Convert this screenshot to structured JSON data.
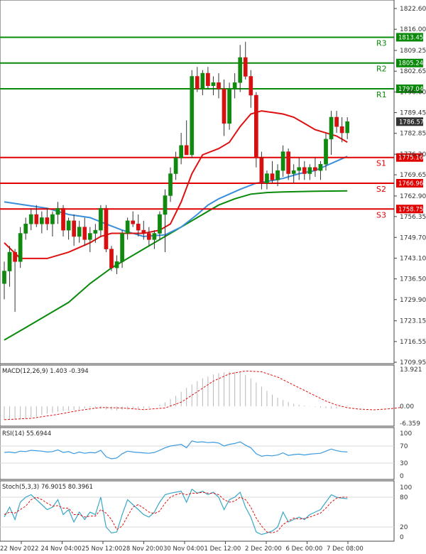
{
  "chart_data": {
    "type": "candlestick",
    "price_axis_ticks": [
      "1822.60",
      "1816.00",
      "1809.25",
      "1802.65",
      "1796.00",
      "1789.45",
      "1782.85",
      "1776.20",
      "1769.65",
      "1762.90",
      "1756.35",
      "1749.70",
      "1743.10",
      "1736.50",
      "1729.90",
      "1723.15",
      "1716.55",
      "1709.95"
    ],
    "price_range": [
      1709.95,
      1822.6
    ],
    "x_labels": [
      "22 Nov 2022",
      "24 Nov 04:00",
      "25 Nov 12:00",
      "28 Nov 20:00",
      "30 Nov 04:00",
      "1 Dec 12:00",
      "2 Dec 20:00",
      "6 Dec 00:00",
      "7 Dec 08:00"
    ],
    "last_price": "1786.57",
    "levels": [
      {
        "name": "R3",
        "value": 1813.45,
        "value_label": "1813.45",
        "color": "#0a8a0a"
      },
      {
        "name": "R2",
        "value": 1805.24,
        "value_label": "1805.24",
        "color": "#0a8a0a"
      },
      {
        "name": "R1",
        "value": 1797.04,
        "value_label": "1797.04",
        "color": "#0a8a0a"
      },
      {
        "name": "S1",
        "value": 1775.16,
        "value_label": "1775.16",
        "color": "#e00000"
      },
      {
        "name": "S2",
        "value": 1766.96,
        "value_label": "1766.96",
        "color": "#e00000"
      },
      {
        "name": "S3",
        "value": 1758.75,
        "value_label": "1758.75",
        "color": "#e00000"
      }
    ],
    "candles": [
      [
        1735,
        1742,
        1730,
        1739
      ],
      [
        1739,
        1747,
        1734,
        1745
      ],
      [
        1745,
        1746,
        1726,
        1742
      ],
      [
        1742,
        1753,
        1740,
        1751
      ],
      [
        1751,
        1756,
        1749,
        1754
      ],
      [
        1754,
        1759,
        1752,
        1757
      ],
      [
        1757,
        1760,
        1753,
        1754
      ],
      [
        1754,
        1758,
        1751,
        1756
      ],
      [
        1756,
        1759,
        1752,
        1754
      ],
      [
        1754,
        1758,
        1750,
        1757
      ],
      [
        1757,
        1761,
        1754,
        1759
      ],
      [
        1759,
        1760,
        1750,
        1752
      ],
      [
        1752,
        1756,
        1749,
        1755
      ],
      [
        1755,
        1757,
        1747,
        1750
      ],
      [
        1750,
        1755,
        1748,
        1753
      ],
      [
        1753,
        1756,
        1747,
        1749
      ],
      [
        1749,
        1753,
        1745,
        1751
      ],
      [
        1751,
        1754,
        1748,
        1752
      ],
      [
        1752,
        1760,
        1750,
        1759
      ],
      [
        1759,
        1760,
        1745,
        1746
      ],
      [
        1746,
        1747,
        1739,
        1740
      ],
      [
        1740,
        1744,
        1738,
        1742
      ],
      [
        1742,
        1752,
        1740,
        1751
      ],
      [
        1751,
        1756,
        1749,
        1755
      ],
      [
        1755,
        1758,
        1753,
        1754
      ],
      [
        1754,
        1757,
        1750,
        1752
      ],
      [
        1752,
        1755,
        1749,
        1751
      ],
      [
        1751,
        1753,
        1747,
        1749
      ],
      [
        1749,
        1752,
        1746,
        1751
      ],
      [
        1751,
        1758,
        1749,
        1757
      ],
      [
        1757,
        1765,
        1745,
        1763
      ],
      [
        1763,
        1772,
        1761,
        1770
      ],
      [
        1770,
        1777,
        1768,
        1775
      ],
      [
        1775,
        1783,
        1773,
        1779
      ],
      [
        1779,
        1787,
        1777,
        1776
      ],
      [
        1776,
        1803,
        1775,
        1801
      ],
      [
        1801,
        1804,
        1796,
        1797
      ],
      [
        1797,
        1803,
        1795,
        1802
      ],
      [
        1802,
        1804,
        1797,
        1798
      ],
      [
        1798,
        1801,
        1795,
        1799
      ],
      [
        1799,
        1802,
        1794,
        1797
      ],
      [
        1797,
        1800,
        1782,
        1786
      ],
      [
        1786,
        1799,
        1784,
        1797
      ],
      [
        1797,
        1802,
        1794,
        1799
      ],
      [
        1799,
        1811,
        1796,
        1807
      ],
      [
        1807,
        1812,
        1800,
        1801
      ],
      [
        1801,
        1803,
        1791,
        1795
      ],
      [
        1795,
        1796,
        1772,
        1775
      ],
      [
        1775,
        1777,
        1765,
        1767
      ],
      [
        1767,
        1771,
        1765,
        1770
      ],
      [
        1770,
        1774,
        1767,
        1768
      ],
      [
        1768,
        1773,
        1766,
        1771
      ],
      [
        1771,
        1779,
        1769,
        1777
      ],
      [
        1777,
        1778,
        1768,
        1770
      ],
      [
        1770,
        1773,
        1767,
        1771
      ],
      [
        1771,
        1775,
        1768,
        1772
      ],
      [
        1772,
        1774,
        1768,
        1770
      ],
      [
        1770,
        1773,
        1768,
        1772
      ],
      [
        1772,
        1775,
        1769,
        1771
      ],
      [
        1771,
        1774,
        1768,
        1773
      ],
      [
        1773,
        1783,
        1771,
        1781
      ],
      [
        1781,
        1790,
        1776,
        1788
      ],
      [
        1788,
        1790,
        1783,
        1785
      ],
      [
        1785,
        1788,
        1780,
        1783
      ],
      [
        1783,
        1788,
        1781,
        1786.57
      ]
    ],
    "ma_red": [
      [
        0,
        1748
      ],
      [
        3,
        1743
      ],
      [
        8,
        1743
      ],
      [
        12,
        1745
      ],
      [
        16,
        1748
      ],
      [
        18,
        1750
      ],
      [
        20,
        1751
      ],
      [
        26,
        1751
      ],
      [
        29,
        1752
      ],
      [
        31,
        1754
      ],
      [
        33,
        1761
      ],
      [
        35,
        1770
      ],
      [
        37,
        1776
      ],
      [
        40,
        1778
      ],
      [
        42,
        1780
      ],
      [
        44,
        1785
      ],
      [
        46,
        1789
      ],
      [
        48,
        1790
      ],
      [
        50,
        1789.5
      ],
      [
        52,
        1789
      ],
      [
        54,
        1788
      ],
      [
        56,
        1786
      ],
      [
        58,
        1784
      ],
      [
        60,
        1783
      ],
      [
        62,
        1782
      ],
      [
        64,
        1780
      ]
    ],
    "ma_blue": [
      [
        0,
        1761
      ],
      [
        4,
        1760
      ],
      [
        8,
        1759
      ],
      [
        12,
        1757
      ],
      [
        16,
        1756
      ],
      [
        19,
        1754
      ],
      [
        22,
        1752
      ],
      [
        26,
        1750
      ],
      [
        30,
        1750.5
      ],
      [
        33,
        1753
      ],
      [
        36,
        1757
      ],
      [
        38,
        1760
      ],
      [
        40,
        1762
      ],
      [
        44,
        1765
      ],
      [
        47,
        1767
      ],
      [
        49,
        1767.5
      ],
      [
        52,
        1768.5
      ],
      [
        55,
        1770
      ],
      [
        58,
        1771
      ],
      [
        60,
        1772.5
      ],
      [
        62,
        1774
      ],
      [
        64,
        1775.5
      ]
    ],
    "ma_green": [
      [
        0,
        1717
      ],
      [
        4,
        1721
      ],
      [
        8,
        1725
      ],
      [
        12,
        1729
      ],
      [
        16,
        1735
      ],
      [
        20,
        1740
      ],
      [
        24,
        1744
      ],
      [
        28,
        1748
      ],
      [
        32,
        1752
      ],
      [
        36,
        1756
      ],
      [
        40,
        1760
      ],
      [
        43,
        1762
      ],
      [
        46,
        1763.5
      ],
      [
        49,
        1764
      ],
      [
        52,
        1764.2
      ],
      [
        55,
        1764.3
      ],
      [
        58,
        1764.4
      ],
      [
        64,
        1764.5
      ]
    ],
    "macd": {
      "label": "MACD(12,26,9) 1.403 -0.394",
      "axis_ticks": [
        "13.921",
        "0.00",
        "-6.359"
      ],
      "range": [
        -6.359,
        13.921
      ],
      "hist": [
        -5,
        -5,
        -5,
        -4.8,
        -4.5,
        -4.2,
        -3.8,
        -3.2,
        -2.8,
        -2.5,
        -2,
        -1.7,
        -1.5,
        -1.3,
        -1,
        -0.8,
        -0.6,
        -0.8,
        -1,
        -1.2,
        -1.4,
        -1.5,
        -1.3,
        -1.2,
        -1.1,
        -1,
        -0.8,
        -0.5,
        0,
        0.6,
        1.5,
        2.7,
        4,
        5.5,
        7,
        8.2,
        9.5,
        10.5,
        11.2,
        12,
        12.5,
        12.8,
        13,
        13,
        12.7,
        11.8,
        10.5,
        9,
        7.4,
        5.8,
        4.4,
        3.3,
        2.4,
        1.6,
        1,
        0.6,
        0.3,
        0.1,
        -0.2,
        -0.5,
        -0.7,
        -0.9,
        -0.7,
        -0.2,
        0.3
      ],
      "signal": [
        [
          0,
          -5
        ],
        [
          5,
          -4.5
        ],
        [
          10,
          -3
        ],
        [
          14,
          -1.5
        ],
        [
          18,
          -0.4
        ],
        [
          22,
          -0.6
        ],
        [
          26,
          -1.2
        ],
        [
          30,
          -0.6
        ],
        [
          33,
          1.6
        ],
        [
          36,
          5.5
        ],
        [
          39,
          9.5
        ],
        [
          42,
          12.2
        ],
        [
          45,
          13.3
        ],
        [
          48,
          13
        ],
        [
          51,
          11
        ],
        [
          54,
          8
        ],
        [
          57,
          5
        ],
        [
          60,
          2
        ],
        [
          62,
          0.5
        ],
        [
          64,
          -0.5
        ],
        [
          66,
          -1
        ],
        [
          69,
          -1.3
        ],
        [
          72,
          -0.9
        ],
        [
          74,
          -0.4
        ]
      ]
    },
    "rsi": {
      "label": "RSI(14) 55.6944",
      "axis_ticks": [
        "100",
        "70",
        "30",
        "0"
      ],
      "values": [
        55,
        56,
        54,
        58,
        57,
        60,
        59,
        58,
        56,
        57,
        61,
        55,
        57,
        52,
        56,
        53,
        55,
        54,
        60,
        45,
        40,
        42,
        52,
        58,
        56,
        55,
        54,
        53,
        55,
        60,
        66,
        70,
        72,
        74,
        66,
        82,
        79,
        80,
        78,
        79,
        77,
        70,
        74,
        76,
        80,
        72,
        66,
        52,
        46,
        48,
        47,
        49,
        54,
        48,
        50,
        51,
        49,
        51,
        52,
        53,
        58,
        63,
        59,
        57,
        56
      ]
    },
    "stoch": {
      "label": "Stoch(5,3,3) 76.9015 80.3961",
      "axis_ticks": [
        "100",
        "80",
        "20",
        "0"
      ],
      "k": [
        40,
        60,
        35,
        70,
        80,
        85,
        75,
        65,
        55,
        60,
        75,
        45,
        55,
        30,
        50,
        35,
        50,
        45,
        80,
        20,
        8,
        10,
        45,
        75,
        65,
        55,
        45,
        40,
        50,
        70,
        85,
        88,
        90,
        92,
        70,
        96,
        88,
        92,
        85,
        90,
        80,
        55,
        75,
        80,
        90,
        60,
        40,
        10,
        5,
        8,
        12,
        20,
        50,
        30,
        35,
        40,
        35,
        45,
        50,
        55,
        70,
        85,
        80,
        78,
        77
      ],
      "d": [
        45,
        50,
        48,
        55,
        62,
        75,
        80,
        75,
        68,
        62,
        63,
        58,
        58,
        45,
        45,
        40,
        42,
        42,
        55,
        48,
        35,
        15,
        22,
        42,
        60,
        65,
        58,
        50,
        47,
        52,
        68,
        80,
        85,
        88,
        85,
        88,
        88,
        90,
        88,
        88,
        85,
        75,
        70,
        72,
        80,
        75,
        60,
        38,
        22,
        10,
        8,
        12,
        25,
        32,
        38,
        36,
        37,
        40,
        44,
        48,
        58,
        70,
        78,
        80,
        80
      ]
    }
  }
}
